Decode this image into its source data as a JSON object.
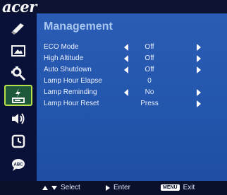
{
  "brand": {
    "logo": "acer"
  },
  "panel": {
    "title": "Management"
  },
  "rows": [
    {
      "label": "ECO Mode",
      "value": "Off",
      "left_arrow": true,
      "right_arrow": true
    },
    {
      "label": "High Altitude",
      "value": "Off",
      "left_arrow": true,
      "right_arrow": true
    },
    {
      "label": "Auto Shutdown",
      "value": "Off",
      "left_arrow": true,
      "right_arrow": true
    },
    {
      "label": "Lamp Hour Elapse",
      "value": "0",
      "left_arrow": false,
      "right_arrow": false
    },
    {
      "label": "Lamp Reminding",
      "value": "No",
      "left_arrow": true,
      "right_arrow": true
    },
    {
      "label": "Lamp Hour Reset",
      "value": "Press",
      "left_arrow": false,
      "right_arrow": true
    }
  ],
  "sidebar": {
    "items": [
      {
        "icon": "color-wand-icon"
      },
      {
        "icon": "image-icon"
      },
      {
        "icon": "settings-icon"
      },
      {
        "icon": "management-icon",
        "selected": true
      },
      {
        "icon": "audio-icon"
      },
      {
        "icon": "timer-icon"
      },
      {
        "icon": "language-icon",
        "text": "ABC"
      }
    ]
  },
  "footer": {
    "select_label": "Select",
    "enter_label": "Enter",
    "menu_key": "MENU",
    "exit_label": "Exit"
  },
  "colors": {
    "panel_blue": "#2b5cb5",
    "title_blue": "#a9c6ef",
    "selected_border": "#b8e04a"
  }
}
